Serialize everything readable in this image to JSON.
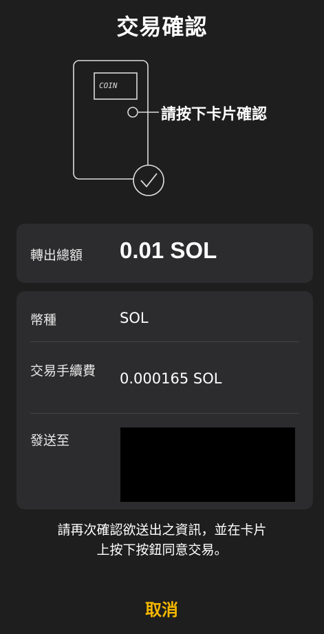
{
  "header": {
    "title": "交易確認"
  },
  "illustration": {
    "screen_text": "COIN",
    "press_label": "請按下卡片確認"
  },
  "amount": {
    "label": "轉出總額",
    "value": "0.01 SOL"
  },
  "details": {
    "currency_label": "幣種",
    "currency_value": "SOL",
    "fee_label": "交易手續費",
    "fee_value": "0.000165 SOL",
    "to_label": "發送至"
  },
  "note": {
    "line1": "請再次確認欲送出之資訊，並在卡片",
    "line2": "上按下按鈕同意交易。"
  },
  "actions": {
    "cancel_label": "取消"
  },
  "colors": {
    "background": "#1e1e1e",
    "panel": "#2c2c2e",
    "accent": "#f5b800"
  }
}
